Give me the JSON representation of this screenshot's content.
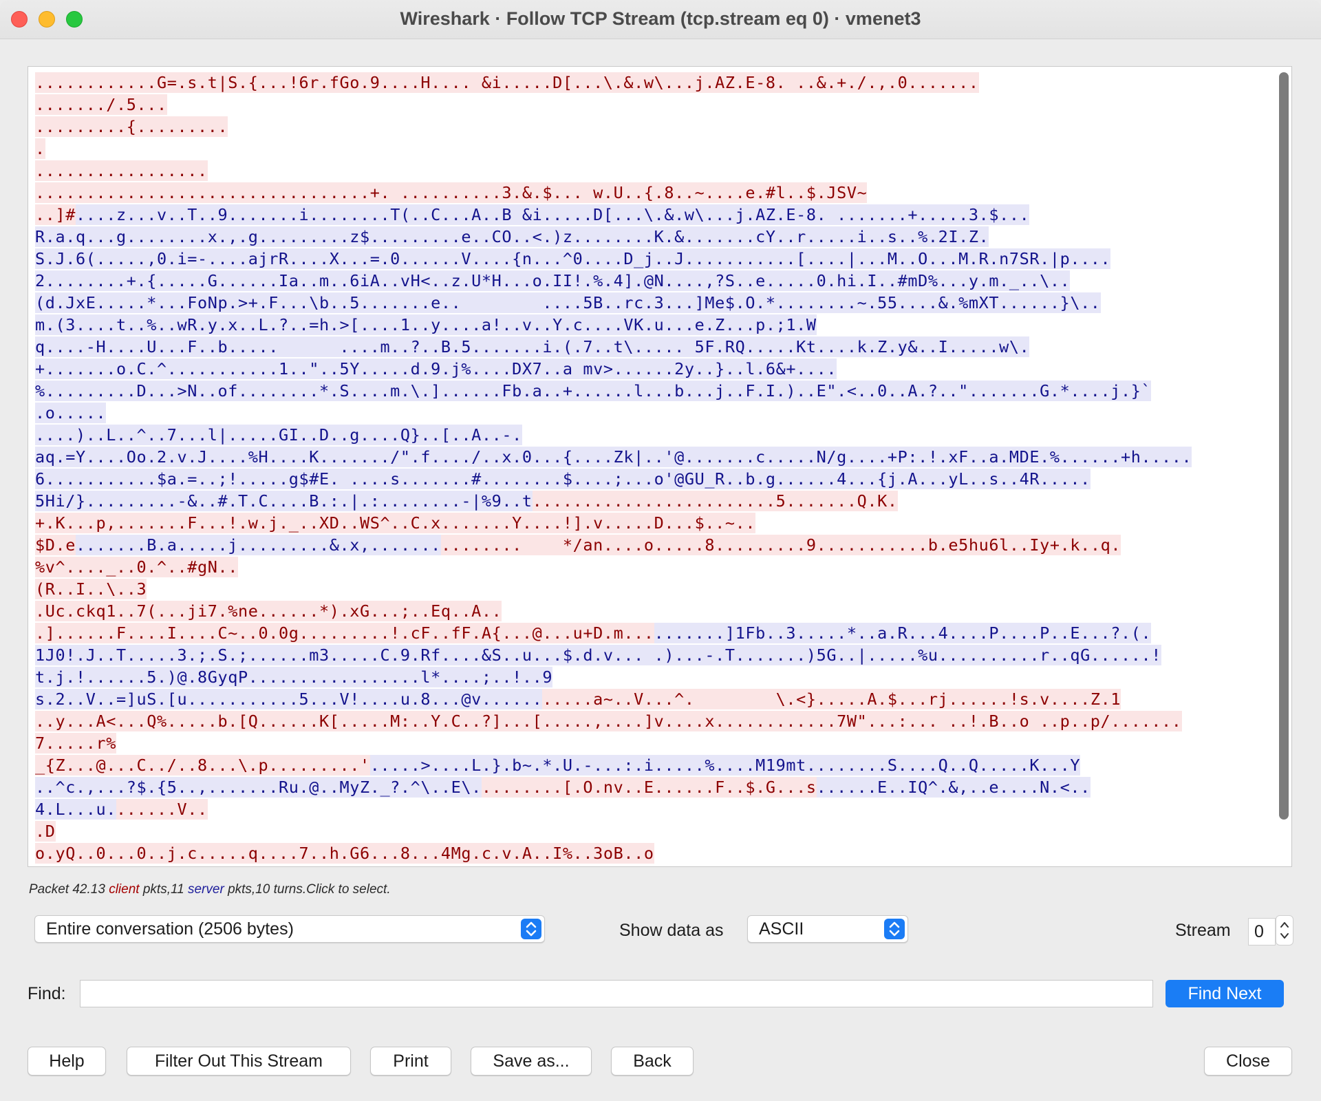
{
  "window": {
    "title": "Wireshark · Follow TCP Stream (tcp.stream eq 0) · vmenet3"
  },
  "stream": {
    "lines": [
      [
        [
          "c",
          "............G=.s.t|S.{...!6r.fGo.9....H.... &i.....D[...\\.&.w\\...j.AZ.E-8. ..&.+./.,.0......."
        ]
      ],
      [
        [
          "c",
          "......./.5..."
        ]
      ],
      [
        [
          "c",
          ".........{........."
        ]
      ],
      [
        [
          "c",
          "."
        ]
      ],
      [
        [
          "c",
          "................."
        ]
      ],
      [
        [
          "c",
          ".................................+. ..........3.&.$... w.U..{.8..~....e.#l..$.JSV~"
        ]
      ],
      [
        [
          "c",
          "..]#"
        ],
        [
          "s",
          "....z...v..T..9.......i........T(..C...A..B &i.....D[...\\.&.w\\...j.AZ.E-8. .......+.....3.$..."
        ]
      ],
      [
        [
          "s",
          "R.a.q...g........x.,.g.........z$.........e..CO..<.)z........K.&.......cY..r.....i..s..%.2I.Z."
        ]
      ],
      [
        [
          "s",
          "S.J.6(.....,0.i=-....ajrR....X...=.0......V....{n...^0....D_j..J...........[....|...M..O...M.R.n7SR.|p...."
        ]
      ],
      [
        [
          "s",
          "2........+.{.....G......Ia..m..6iA..vH<..z.U*H...o.II!.%.4].@N....,?S..e.....0.hi.I..#mD%...y.m._..\\.."
        ]
      ],
      [
        [
          "s",
          "(d.JxE.....*...FoNp.>+.F...\\b..5.......e..        ....5B..rc.3...]Me$.O.*........~.55....&.%mXT......}\\.."
        ]
      ],
      [
        [
          "s",
          "m.(3....t..%..wR.y.x..L.?..=h.>[....1..y....a!..v..Y.c....VK.u...e.Z...p.;1.W"
        ]
      ],
      [
        [
          "s",
          "q....-H....U...F..b.....      ....m..?..B.5.......i.(.7..t\\..... 5F.RQ.....Kt....k.Z.y&..I.....w\\."
        ]
      ],
      [
        [
          "s",
          "+.......o.C.^...........1..\"..5Y.....d.9.j%....DX7..a mv>......2y..}..l.6&+...."
        ]
      ],
      [
        [
          "s",
          "%.........D...>N..of........*.S....m.\\.]......Fb.a..+......l...b...j..F.I.)..E\".<..0..A.?..\".......G.*....j.}`"
        ]
      ],
      [
        [
          "s",
          ".o....."
        ]
      ],
      [
        [
          "s",
          "....)..L..^..7...l|.....GI..D..g....Q}..[..A..-."
        ]
      ],
      [
        [
          "s",
          "aq.=Y....Oo.2.v.J....%H....K......./\".f..../..x.0...{....Zk|..'@.......c.....N/g....+P:.!.xF..a.MDE.%......+h....."
        ]
      ],
      [
        [
          "s",
          "6...........$a.=..;!.....g$#E. ....s.......#........$....;...o'@GU_R..b.g......4...{j.A...yL..s..4R....."
        ]
      ],
      [
        [
          "s",
          "5Hi/}.........-&..#.T.C....B.:.|.:........-|%9..t"
        ],
        [
          "c",
          "........................5.......Q.K."
        ]
      ],
      [
        [
          "c",
          "+.K...p,.......F...!.w.j._..XD..WS^..C.x.......Y....!].v.....D...$..~.."
        ]
      ],
      [
        [
          "c",
          "$D.e"
        ],
        [
          "s",
          ".......B.a.....j.........&.x,......."
        ],
        [
          "c",
          "........    */an....o.....8.........9...........b.e5hu6l..Iy+.k..q."
        ]
      ],
      [
        [
          "c",
          "%v^...._..0.^..#gN.."
        ]
      ],
      [
        [
          "c",
          "(R..I..\\..3"
        ]
      ],
      [
        [
          "c",
          ".Uc.ckq1..7(...ji7.%ne......*).xG...;..Eq..A.."
        ]
      ],
      [
        [
          "c",
          ".]......F....I....C~..0.0g.........!.cF..fF.A{...@...u+D.m..."
        ],
        [
          "s",
          ".......]1Fb..3.....*..a.R...4....P....P..E...?.(."
        ]
      ],
      [
        [
          "s",
          "1J0!.J..T.....3.;.S.;......m3.....C.9.Rf....&S..u...$.d.v... .)...-.T.......)5G..|.....%u..........r..qG......!"
        ]
      ],
      [
        [
          "s",
          "t.j.!......5.)@.8GyqP.................l*....;..!..9"
        ]
      ],
      [
        [
          "s",
          "s.2..V..=]uS.[u...........5...V!....u.8...@v......"
        ],
        [
          "c",
          ".....a~..V...^.        \\.<}.....A.$...rj......!s.v....Z.1"
        ]
      ],
      [
        [
          "c",
          "..y...A<...Q%.....b.[Q......K[.....M:..Y.C..?]...[.....,....]v....x............7W\"...:... ..!.B..o ..p..p/......."
        ]
      ],
      [
        [
          "c",
          "7.....r%"
        ]
      ],
      [
        [
          "c",
          "_{Z...@...C../..8...\\.p.........'"
        ],
        [
          "s",
          ".....>....L.}.b~.*.U.-...:.i.....%....M19mt........S....Q..Q.....K...Y"
        ]
      ],
      [
        [
          "s",
          "..^c.,...?$.{5..,.......Ru.@..MyZ._?.^\\..E\\."
        ],
        [
          "c",
          "........[.O.nv..E......F..$.G...s"
        ],
        [
          "s",
          "......E..IQ^.&,..e....N.<.."
        ]
      ],
      [
        [
          "s",
          "4.L...u."
        ],
        [
          "c",
          "......V.."
        ]
      ],
      [
        [
          "c",
          ".D"
        ]
      ],
      [
        [
          "c",
          "o.yQ..0...0..j.c.....q....7..h.G6...8...4Mg.c.v.A..I%..3oB..o"
        ]
      ]
    ]
  },
  "status": {
    "prefix": "Packet 42.",
    "client_count": "13",
    "client_label": "client",
    "mid": "pkts,11",
    "server_label": "server",
    "suffix": "pkts,10 turns.Click to select."
  },
  "controls": {
    "conversation_value": "Entire conversation (2506 bytes)",
    "show_data_label": "Show data as",
    "show_data_value": "ASCII",
    "stream_label": "Stream",
    "stream_value": "0",
    "find_label": "Find:",
    "find_value": "",
    "find_next": "Find Next"
  },
  "buttons": {
    "help": "Help",
    "filter_out": "Filter Out This Stream",
    "print": "Print",
    "save_as": "Save as...",
    "back": "Back",
    "close": "Close"
  },
  "colors": {
    "client_bg": "#fbe5e5",
    "client_fg": "#8c0000",
    "server_bg": "#e6e6f8",
    "server_fg": "#13138c",
    "accent": "#1a7df5"
  }
}
